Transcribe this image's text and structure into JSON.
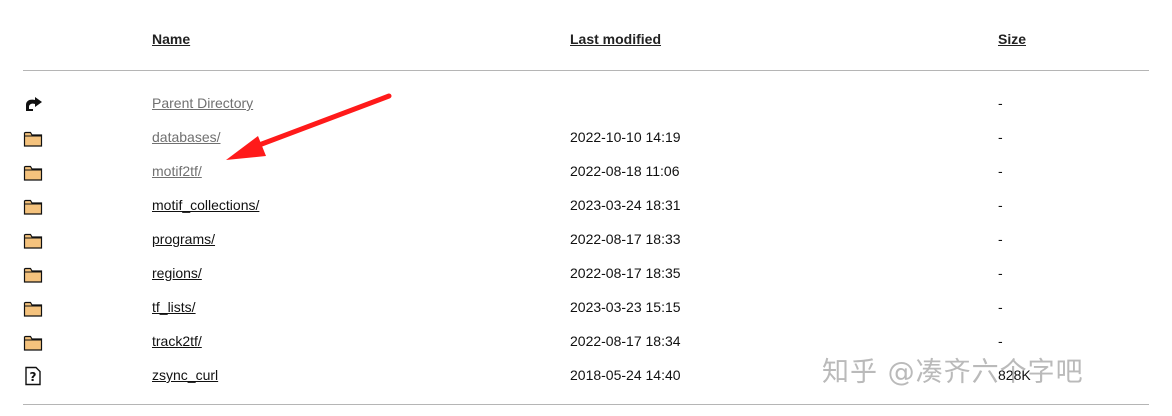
{
  "headers": {
    "name": "Name",
    "last_modified": "Last modified",
    "size": "Size"
  },
  "rows": [
    {
      "icon": "back-arrow-icon",
      "name": "Parent Directory",
      "date": "",
      "size": "-",
      "visited": true
    },
    {
      "icon": "folder-icon",
      "name": "databases/",
      "date": "2022-10-10 14:19",
      "size": "-",
      "visited": true
    },
    {
      "icon": "folder-icon",
      "name": "motif2tf/",
      "date": "2022-08-18 11:06",
      "size": "-",
      "visited": true
    },
    {
      "icon": "folder-icon",
      "name": "motif_collections/",
      "date": "2023-03-24 18:31",
      "size": "-",
      "visited": false
    },
    {
      "icon": "folder-icon",
      "name": "programs/",
      "date": "2022-08-17 18:33",
      "size": "-",
      "visited": false
    },
    {
      "icon": "folder-icon",
      "name": "regions/",
      "date": "2022-08-17 18:35",
      "size": "-",
      "visited": false
    },
    {
      "icon": "folder-icon",
      "name": "tf_lists/",
      "date": "2023-03-23 15:15",
      "size": "-",
      "visited": false
    },
    {
      "icon": "folder-icon",
      "name": "track2tf/",
      "date": "2022-08-17 18:34",
      "size": "-",
      "visited": false
    },
    {
      "icon": "unknown-file-icon",
      "name": "zsync_curl",
      "date": "2018-05-24 14:40",
      "size": "828K",
      "visited": false
    }
  ],
  "watermark": "知乎 @凑齐六个字吧",
  "colors": {
    "arrow": "#ff1a1a",
    "folder_fill": "#f4c27d",
    "link": "#111111",
    "visited_link": "#707070"
  }
}
